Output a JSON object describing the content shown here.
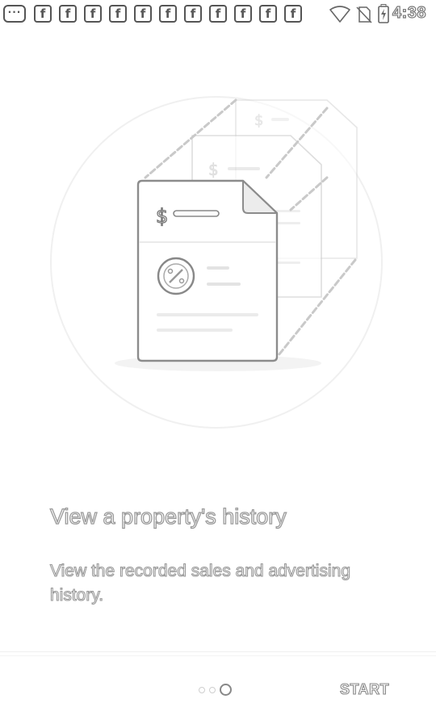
{
  "status_bar": {
    "notification_icons": [
      "messages-icon",
      "facebook-icon",
      "facebook-icon",
      "facebook-icon",
      "facebook-icon",
      "facebook-icon",
      "facebook-icon",
      "facebook-icon",
      "facebook-icon",
      "facebook-icon",
      "facebook-icon",
      "facebook-icon"
    ],
    "notification_glyphs": {
      "messages": "···",
      "facebook": "f"
    },
    "time": "4:38"
  },
  "illustration": {
    "icons": [
      "document-icon",
      "dollar-icon",
      "discount-badge-icon",
      "chain-icon"
    ],
    "dollar_glyph": "$"
  },
  "onboarding": {
    "title": "View a property's history",
    "description": "View the recorded sales and advertising history."
  },
  "pager": {
    "page_count": 3,
    "active_index": 2
  },
  "nav": {
    "start_label": "START"
  }
}
